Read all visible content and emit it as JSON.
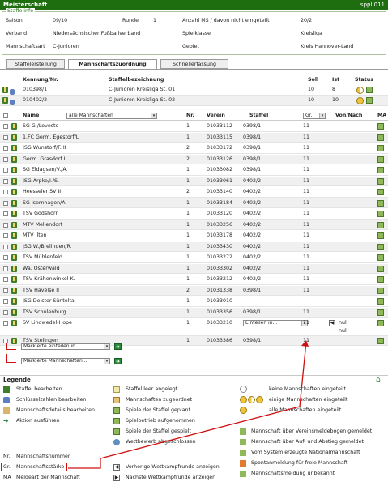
{
  "header": {
    "title": "Meisterschaft",
    "user": "sppl 011"
  },
  "info": {
    "legend": "Staffelinfo",
    "saison_label": "Saison",
    "saison": "09/10",
    "runde_label": "Runde",
    "runde": "1",
    "verband_label": "Verband",
    "verband": "Niedersächsischer Fußballverband",
    "art_label": "Mannschaftsart",
    "art": "C-Junioren",
    "anzahl_label": "Anzahl MS / davon nicht eingeteilt",
    "anzahl": "20/2",
    "klasse_label": "Spielklasse",
    "klasse": "Kreisliga",
    "gebiet_label": "Gebiet",
    "gebiet": "Kreis Hannover-Land"
  },
  "tabs": [
    "Staffelerstellung",
    "Mannschaftszuordnung",
    "Schnellerfassung"
  ],
  "staffel_table": {
    "headers": [
      "Kennung/Nr.",
      "Staffelbezeichnung",
      "Soll",
      "Ist",
      "Status"
    ],
    "rows": [
      {
        "kennung": "010398/1",
        "bez": "C-Junioren Kreisliga St. 01",
        "soll": "10",
        "ist": "8"
      },
      {
        "kennung": "010402/2",
        "bez": "C-Junioren Kreisliga St. 02",
        "soll": "10",
        "ist": "10"
      }
    ]
  },
  "team_table": {
    "h_name": "Name",
    "filter": "alle Mannschaften",
    "h_nr": "Nr.",
    "h_verein": "Verein",
    "h_staffel": "Staffel",
    "gr_select": "Gr.",
    "h_vonnach": "Von/Nach",
    "h_ma": "MA",
    "rows": [
      {
        "name": "SG G./Leveste",
        "nr": "1",
        "verein": "01033112",
        "staffel": "0398/1",
        "gr": "11"
      },
      {
        "name": "1.FC Germ. Egestorf/L",
        "nr": "1",
        "verein": "01033115",
        "staffel": "0398/1",
        "gr": "11"
      },
      {
        "name": "JSG Wunstorf/F. II",
        "nr": "2",
        "verein": "01033172",
        "staffel": "0398/1",
        "gr": "11"
      },
      {
        "name": "Germ. Grasdorf II",
        "nr": "2",
        "verein": "01033126",
        "staffel": "0398/1",
        "gr": "11"
      },
      {
        "name": "SG Eldagsen/V./A.",
        "nr": "1",
        "verein": "01033082",
        "staffel": "0398/1",
        "gr": "11"
      },
      {
        "name": "JSG Arpke/I./S.",
        "nr": "1",
        "verein": "01033061",
        "staffel": "0402/2",
        "gr": "11"
      },
      {
        "name": "Heesseler SV II",
        "nr": "2",
        "verein": "01033140",
        "staffel": "0402/2",
        "gr": "11"
      },
      {
        "name": "SG Isernhagen/A.",
        "nr": "1",
        "verein": "01033184",
        "staffel": "0402/2",
        "gr": "11"
      },
      {
        "name": "TSV Godshorn",
        "nr": "1",
        "verein": "01033120",
        "staffel": "0402/2",
        "gr": "11"
      },
      {
        "name": "MTV Mellendorf",
        "nr": "1",
        "verein": "01033256",
        "staffel": "0402/2",
        "gr": "11"
      },
      {
        "name": "MTV Ilten",
        "nr": "1",
        "verein": "01033178",
        "staffel": "0402/2",
        "gr": "11"
      },
      {
        "name": "JSG W./Brelingen/R.",
        "nr": "1",
        "verein": "01033430",
        "staffel": "0402/2",
        "gr": "11"
      },
      {
        "name": "TSV Mühlenfeld",
        "nr": "1",
        "verein": "01033272",
        "staffel": "0402/2",
        "gr": "11"
      },
      {
        "name": "Wa. Osterwald",
        "nr": "1",
        "verein": "01033302",
        "staffel": "0402/2",
        "gr": "11"
      },
      {
        "name": "TSV Krähenwinkel K.",
        "nr": "1",
        "verein": "01033212",
        "staffel": "0402/2",
        "gr": "11"
      },
      {
        "name": "TSV Havelse II",
        "nr": "2",
        "verein": "01031338",
        "staffel": "0398/1",
        "gr": "11"
      },
      {
        "name": "JSG Deister-Sünteltal",
        "nr": "1",
        "verein": "01033010",
        "staffel": "",
        "gr": ""
      },
      {
        "name": "TSV Schulenburg",
        "nr": "1",
        "verein": "01033356",
        "staffel": "0398/1",
        "gr": "11"
      },
      {
        "name": "SV Lindwedel-Hope",
        "nr": "1",
        "verein": "01033210",
        "staffel_select": "Einteilen in...",
        "gr": "11",
        "vonnach": "null",
        "vonnach2": "null"
      },
      {
        "name": "TSV Stelingen",
        "nr": "1",
        "verein": "01033386",
        "staffel": "0398/1",
        "gr": "11"
      }
    ],
    "action1": "Markierte einteilen in...",
    "action2": "Markierte Mannschaften..."
  },
  "legend": {
    "title": "Legende",
    "col1": [
      "Staffel bearbeiten",
      "Schlüsselzahlen bearbeiten",
      "Mannschaftsdetails bearbeiten",
      "Aktion ausführen"
    ],
    "col2": [
      "Staffel leer angelegt",
      "Mannschaften zugeordnet",
      "Spiele der Staffel geplant",
      "Spielbetrieb aufgenommen",
      "Spiele der Staffel gespielt",
      "Wettbewerb abgeschlossen"
    ],
    "col3": [
      "keine Mannschaften eingeteilt",
      "einige Mannschaften eingeteilt",
      "alle Mannschaften eingeteilt"
    ],
    "col3b": [
      "Mannschaft über Vereinsmeldebogen gemeldet",
      "Mannschaft über Auf- und Abstieg gemeldet",
      "Vom System erzeugte Nationalmannschaft",
      "Spontanmeldung für freie Mannschaft",
      "Mannschaftsmeldung unbekannt"
    ],
    "abbr": [
      {
        "k": "Nr.",
        "v": "Mannschaftsnummer"
      },
      {
        "k": "Gr.",
        "v": "Mannschaftsstärke"
      },
      {
        "k": "MA",
        "v": "Meldeart der Mannschaft"
      }
    ],
    "nav": [
      "Vorherige Wettkampfrunde anzeigen",
      "Nächste Wettkampfrunde anzeigen"
    ]
  },
  "colors": {
    "header": "#1e6e10",
    "highlight": "#d01010"
  }
}
